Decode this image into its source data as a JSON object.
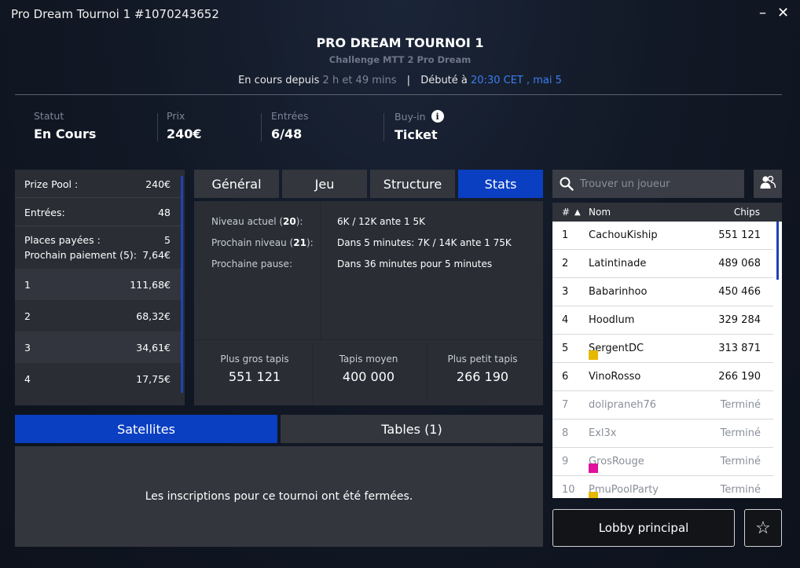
{
  "window": {
    "title": "Pro Dream Tournoi 1 #1070243652",
    "minimize_glyph": "–",
    "close_glyph": "✕"
  },
  "header": {
    "title": "PRO DREAM TOURNOI 1",
    "subtitle": "Challenge MTT 2 Pro Dream",
    "running_label": "En cours depuis",
    "running_value": "2 h et 49 mins",
    "separator": "|",
    "started_label": "Débuté à",
    "started_value": "20:30 CET , mai 5"
  },
  "summary": {
    "status_label": "Statut",
    "status_value": "En Cours",
    "prize_label": "Prix",
    "prize_value": "240€",
    "entries_label": "Entrées",
    "entries_value": "6/48",
    "buyin_label": "Buy-in",
    "buyin_value": "Ticket",
    "info_glyph": "i"
  },
  "prize_panel": {
    "pool_label": "Prize Pool :",
    "pool_value": "240€",
    "entries_label": "Entrées:",
    "entries_value": "48",
    "paid_label": "Places payées :",
    "paid_value": "5",
    "next_label": "Prochain paiement (5):",
    "next_value": "7,64€",
    "payouts": [
      {
        "place": "1",
        "amount": "111,68€"
      },
      {
        "place": "2",
        "amount": "68,32€"
      },
      {
        "place": "3",
        "amount": "34,61€"
      },
      {
        "place": "4",
        "amount": "17,75€"
      }
    ]
  },
  "tabs": [
    "Général",
    "Jeu",
    "Structure",
    "Stats"
  ],
  "active_tab": "Stats",
  "stats": {
    "current_level_label": "Niveau actuel (",
    "current_level_num": "20",
    "current_level_end": "):",
    "current_level_value": "6K / 12K ante 1 5K",
    "next_level_label": "Prochain niveau (",
    "next_level_num": "21",
    "next_level_end": "):",
    "next_level_value": "Dans 5 minutes: 7K / 14K ante 1 75K",
    "next_break_label": "Prochaine pause:",
    "next_break_value": "Dans 36 minutes pour 5 minutes",
    "biggest_label": "Plus gros tapis",
    "biggest_value": "551 121",
    "average_label": "Tapis moyen",
    "average_value": "400 000",
    "smallest_label": "Plus petit tapis",
    "smallest_value": "266 190"
  },
  "bottom_tabs": [
    "Satellites",
    "Tables (1)"
  ],
  "closed_message": "Les inscriptions pour ce tournoi ont été fermées.",
  "search": {
    "placeholder": "Trouver un joueur"
  },
  "players_header": {
    "rank": "#",
    "sort_glyph": "▲",
    "name": "Nom",
    "chips": "Chips"
  },
  "players": [
    {
      "rank": "1",
      "name": "CachouKiship",
      "chips": "551 121",
      "flag": ""
    },
    {
      "rank": "2",
      "name": "Latintinade",
      "chips": "489 068",
      "flag": ""
    },
    {
      "rank": "3",
      "name": "Babarinhoo",
      "chips": "450 466",
      "flag": ""
    },
    {
      "rank": "4",
      "name": "Hoodlum",
      "chips": "329 284",
      "flag": ""
    },
    {
      "rank": "5",
      "name": "SergentDC",
      "chips": "313 871",
      "flag": "#e6b800"
    },
    {
      "rank": "6",
      "name": "VinoRosso",
      "chips": "266 190",
      "flag": ""
    },
    {
      "rank": "7",
      "name": "dolipraneh76",
      "chips": "Terminé",
      "flag": ""
    },
    {
      "rank": "8",
      "name": "Exl3x",
      "chips": "Terminé",
      "flag": ""
    },
    {
      "rank": "9",
      "name": "GrosRouge",
      "chips": "Terminé",
      "flag": "#e0119d"
    },
    {
      "rank": "10",
      "name": "PmuPoolParty",
      "chips": "Terminé",
      "flag": "#e6b800"
    }
  ],
  "lobby_button": "Lobby principal",
  "star_glyph": "☆",
  "colors": {
    "accent": "#0a3fc2",
    "link": "#3c7ef0",
    "panel": "#2a2d34"
  }
}
